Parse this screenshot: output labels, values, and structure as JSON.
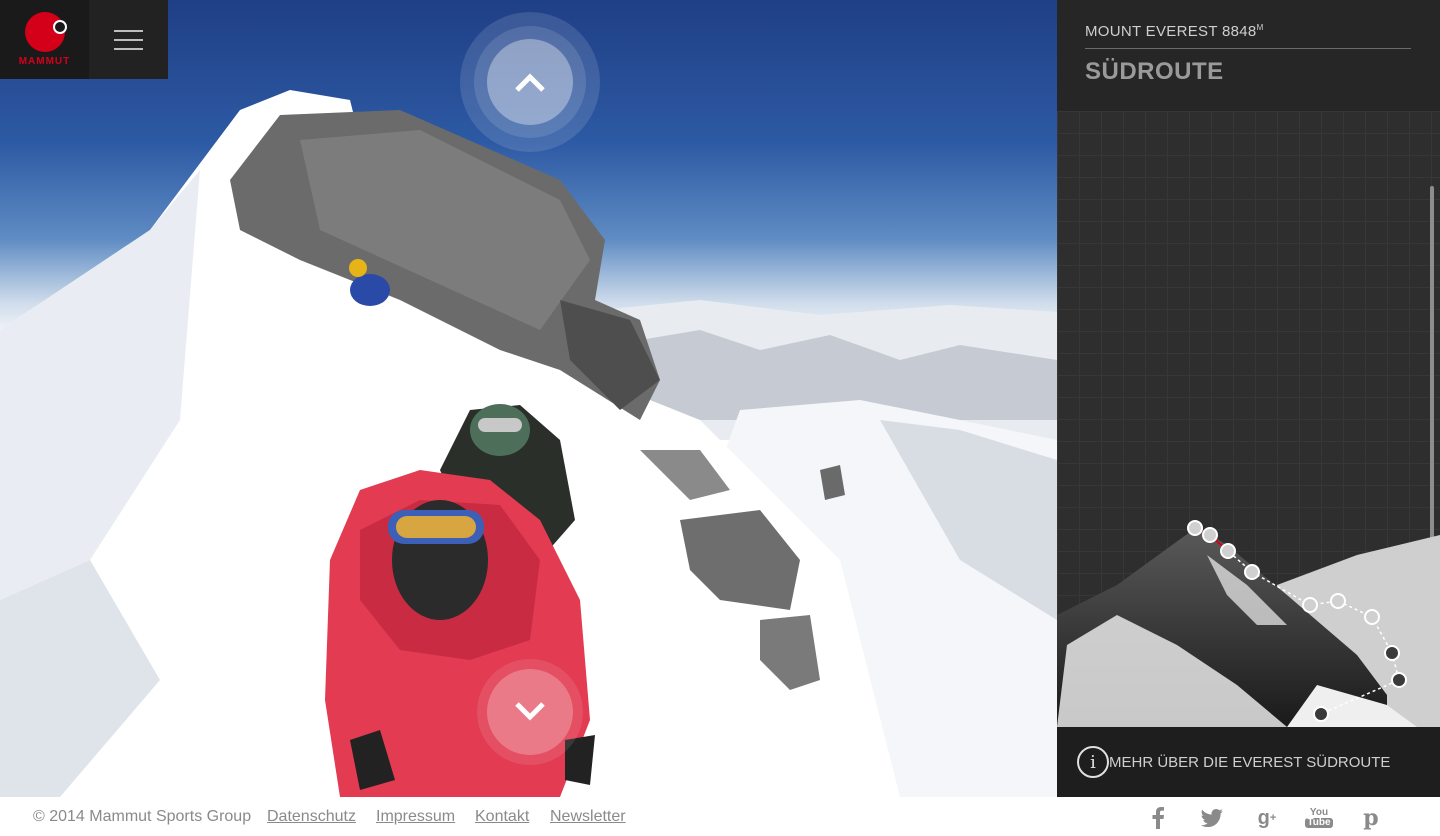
{
  "brand": {
    "name": "MAMMUT",
    "color": "#d4001a"
  },
  "menu": {
    "icon": "hamburger-menu-icon"
  },
  "navigation": {
    "up_icon": "chevron-up-icon",
    "down_icon": "chevron-down-icon"
  },
  "sidebar": {
    "mountain_name": "MOUNT EVEREST 8848",
    "mountain_unit": "M",
    "route_title": "SÜDROUTE",
    "info_icon": "info-icon",
    "info_label": "MEHR ÜBER DIE EVEREST SÜDROUTE"
  },
  "footer": {
    "copyright": "© 2014 Mammut Sports Group",
    "links": [
      "Datenschutz",
      "Impressum",
      "Kontakt",
      "Newsletter"
    ],
    "social": [
      {
        "icon": "facebook-icon",
        "glyph": "f"
      },
      {
        "icon": "twitter-icon",
        "glyph": "t"
      },
      {
        "icon": "google-plus-icon",
        "glyph": "g+"
      },
      {
        "icon": "youtube-icon",
        "glyph": "You Tube"
      },
      {
        "icon": "pinterest-icon",
        "glyph": "p"
      }
    ]
  }
}
